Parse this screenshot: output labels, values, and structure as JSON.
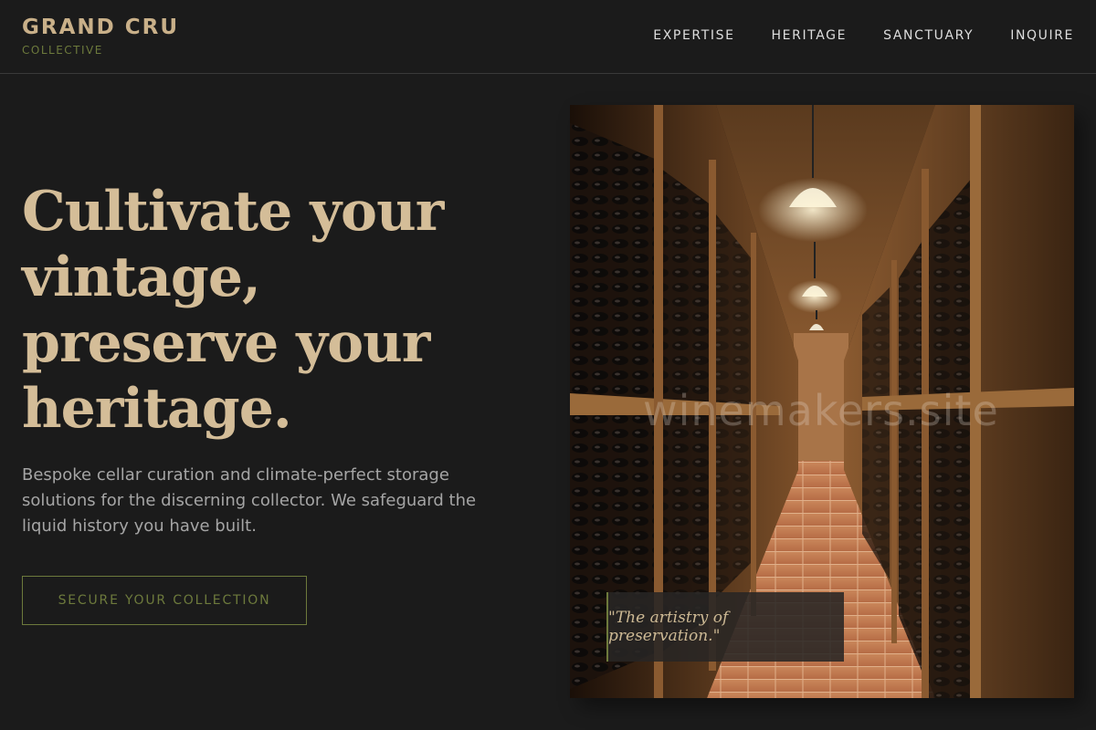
{
  "brand": {
    "title": "GRAND CRU",
    "subtitle": "COLLECTIVE"
  },
  "nav": {
    "items": [
      {
        "label": "EXPERTISE"
      },
      {
        "label": "HERITAGE"
      },
      {
        "label": "SANCTUARY"
      },
      {
        "label": "INQUIRE"
      }
    ]
  },
  "hero": {
    "title_line1": "Cultivate your",
    "title_line2": "vintage,",
    "title_line3": "preserve your",
    "title_line4": "heritage.",
    "subtitle": "Bespoke cellar curation and climate-perfect storage solutions for the discerning collector. We safeguard the liquid history you have built.",
    "cta_label": "SECURE YOUR COLLECTION"
  },
  "image": {
    "subject": "wine cellar corridor with bottle racks",
    "watermark": "winemakers.site",
    "quote": "\"The artistry of preservation.\""
  },
  "colors": {
    "background": "#1b1b1b",
    "gold": "#d4bd98",
    "olive": "#6d7a3c",
    "text_muted": "#a5a5a5"
  }
}
